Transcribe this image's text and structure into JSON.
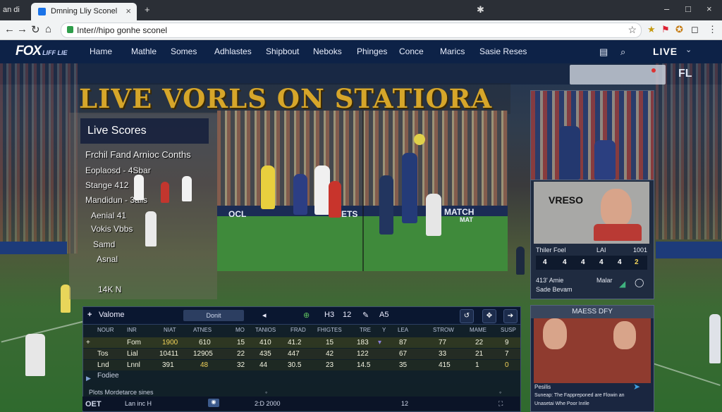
{
  "browser": {
    "left_title": "an di",
    "tab_title": "Dmning Lliy Sconel",
    "url": "Inter//hipo gonhe sconel"
  },
  "site": {
    "logo": "FOX",
    "logo_sub": "LIFF LIE",
    "nav": [
      "Hame",
      "Mathle",
      "Somes",
      "Adhlastes",
      "Shipbout",
      "Neboks",
      "Phinges",
      "Conce",
      "Marics",
      "Sasie Reses"
    ],
    "live_label": "LIVE",
    "fl_mark": "FL"
  },
  "hero": {
    "title": "LIVE VORLS ON STATIORA"
  },
  "live_scores": {
    "heading": "Live Scores",
    "lines": [
      "Frchil Fand Arnioc Conths",
      "Eoplaosd  -  4Sbar",
      "Stange        412",
      "Mandidun -  3alls",
      "Aenial           41",
      "Vokis           Vbbs",
      "Samd",
      "Asnal",
      "14K  N"
    ]
  },
  "video": {
    "ad_left": "OCL",
    "ad_mid": "ETS",
    "ad_right": "MATCH",
    "ad_right2": "MAT"
  },
  "side_cards": {
    "video_label": "VRESO",
    "row1": [
      "Thiler Foel",
      "LAI",
      "1001"
    ],
    "mini_score": [
      "4",
      "4",
      "4",
      "4",
      "4",
      "2"
    ],
    "row2": [
      "413' Amie",
      "Malar"
    ],
    "row3": "Sade Bevam",
    "card3_title": "MAESS DFY",
    "card3_caption": "Pesilis",
    "card3_caption2": "Suneap: The Fappreponed are Flowin an",
    "card3_caption3": "Unasetai Whe Poor Inrile"
  },
  "stats": {
    "title": "Valome",
    "pill": "Donit",
    "bar_items": [
      "H3",
      "12",
      "A5"
    ],
    "headers": [
      "NOUR",
      "INR",
      "NIAT",
      "ATNES",
      "MO",
      "TANIOS",
      "FRAD",
      "FHIGTES",
      "TRE",
      "Y",
      "LEA",
      "STROW",
      "MAME",
      "SUSP"
    ],
    "rows": [
      [
        "Fom",
        "1900",
        "610",
        "15",
        "410",
        "41.2",
        "15",
        "183",
        "",
        "87",
        "77",
        "22",
        "9"
      ],
      [
        "Lial",
        "10411",
        "12905",
        "22",
        "435",
        "447",
        "42",
        "122",
        "",
        "67",
        "33",
        "21",
        "7"
      ],
      [
        "Lnnl",
        "391",
        "48",
        "32",
        "44",
        "30.5",
        "23",
        "14.5",
        "",
        "35",
        "415",
        "1",
        "0"
      ]
    ],
    "row_labels": [
      "+",
      "Tos",
      "Lnd"
    ],
    "extra_label": "Fodiee",
    "footer_text": "Plots Mordetarce   sines",
    "timeline": [
      "OET",
      "Lan inc H",
      "2:D 2000",
      "12"
    ]
  },
  "colors": {
    "nav_bg": "#0d2247",
    "hero_gold": "#d6a62a",
    "highlight_yellow": "#f2d35a"
  }
}
